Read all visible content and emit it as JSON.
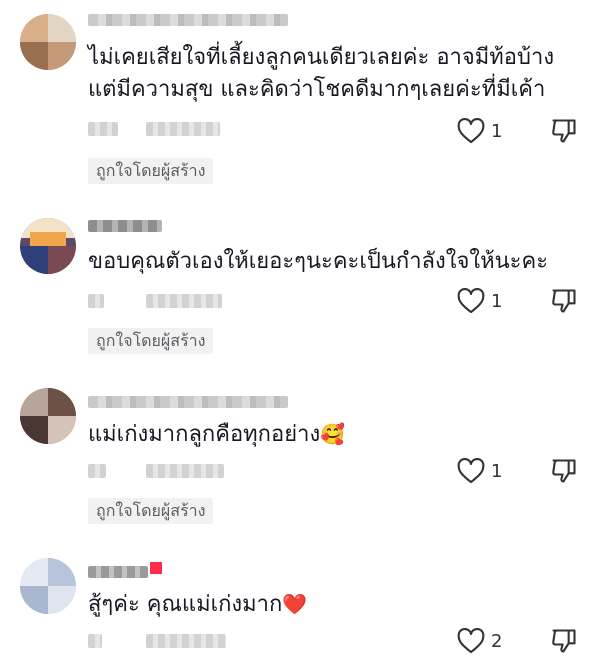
{
  "comments": [
    {
      "text_lines": [
        "ไม่เคยเสียใจที่เลี้ยงลูกคนเดียวเลยค่ะ อาจมีท้อบ้าง",
        "แต่มีความสุข และคิดว่าโชคดีมากๆเลยค่ะที่มีเค้า"
      ],
      "emoji": "",
      "likes": "1",
      "badge": "ถูกใจโดยผู้สร้าง",
      "like_icon": "heart-outline-icon",
      "dislike_icon": "thumbs-down-icon"
    },
    {
      "text_lines": [
        "ขอบคุณตัวเองให้เยอะๆนะคะเป็นกำลังใจให้นะคะ"
      ],
      "emoji": "",
      "likes": "1",
      "badge": "ถูกใจโดยผู้สร้าง",
      "like_icon": "heart-outline-icon",
      "dislike_icon": "thumbs-down-icon"
    },
    {
      "text_lines": [
        "แม่เก่งมากลูกคือทุกอย่าง"
      ],
      "emoji": "🥰",
      "likes": "1",
      "badge": "ถูกใจโดยผู้สร้าง",
      "like_icon": "heart-outline-icon",
      "dislike_icon": "thumbs-down-icon"
    },
    {
      "text_lines": [
        "สู้ๆค่ะ คุณแม่เก่งมาก"
      ],
      "emoji": "❤️",
      "likes": "2",
      "badge": "",
      "like_icon": "heart-outline-icon",
      "dislike_icon": "thumbs-down-icon"
    }
  ],
  "colors": {
    "text": "#161823",
    "badge_bg": "#f1f1f2",
    "badge_text": "#5c5c63",
    "icon": "#333333",
    "heart_emoji": "#e8232e"
  }
}
